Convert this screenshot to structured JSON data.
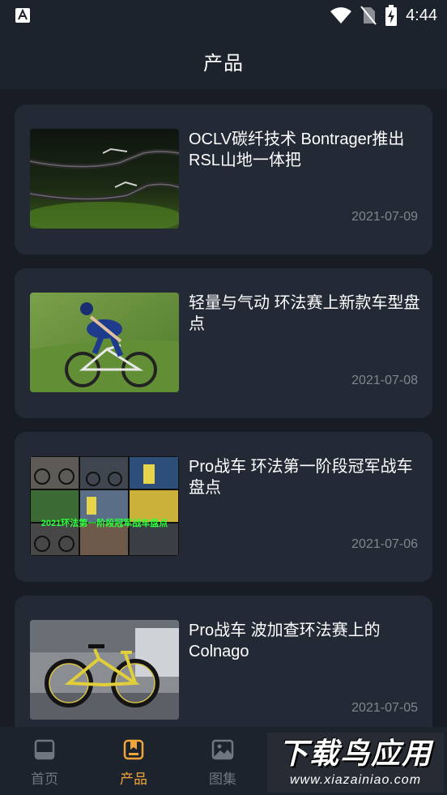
{
  "status_bar": {
    "time": "4:44",
    "left_icon": "android-a-icon",
    "icons": [
      "wifi-icon",
      "no-sim-icon",
      "battery-charging-icon"
    ]
  },
  "header": {
    "title": "产品"
  },
  "articles": [
    {
      "title": "OCLV碳纤技术 Bontrager推出RSL山地一体把",
      "date": "2021-07-09",
      "thumb": "handlebar-photo"
    },
    {
      "title": "轻量与气动 环法赛上新款车型盘点",
      "date": "2021-07-08",
      "thumb": "cyclist-photo"
    },
    {
      "title": "Pro战车 环法第一阶段冠军战车盘点",
      "date": "2021-07-06",
      "thumb": "collage-photo",
      "thumb_caption": "2021环法第一阶段冠军战车盘点"
    },
    {
      "title": "Pro战车 波加查环法赛上的Colnago",
      "date": "2021-07-05",
      "thumb": "bike-photo"
    }
  ],
  "bottom_nav": {
    "items": [
      {
        "label": "首页",
        "icon": "home-icon"
      },
      {
        "label": "产品",
        "icon": "product-icon"
      },
      {
        "label": "图集",
        "icon": "gallery-icon"
      }
    ],
    "active_index": 1
  },
  "watermark": {
    "main": "下载鸟应用",
    "sub": "www.xiazainiao.com"
  },
  "colors": {
    "background": "#171c25",
    "card": "#232a35",
    "accent": "#f0a43a",
    "muted": "#7f8690"
  }
}
